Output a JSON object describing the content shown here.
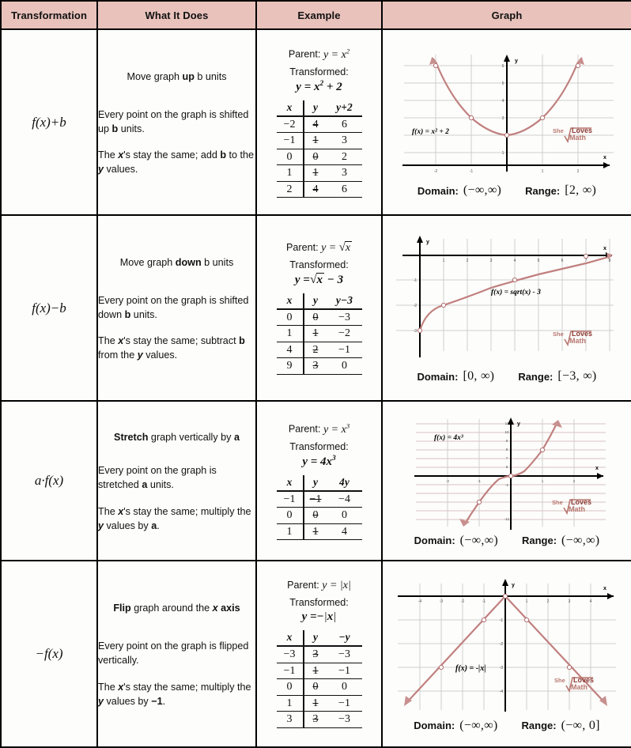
{
  "header": {
    "columns": [
      "Transformation",
      "What It Does",
      "Example",
      "Graph"
    ]
  },
  "watermark": {
    "line1": "She",
    "line2": "Loves",
    "line3": "Math"
  },
  "rows": [
    {
      "notation": "f(x)+b",
      "headline_pre": "Move graph ",
      "headline_bold": "up",
      "headline_post": " b units",
      "para1": "Every point on the graph is shifted up b units.",
      "para2": "The x's stay the same; add b to the y values.",
      "parent_label": "Parent:",
      "parent_eq": "y = x²",
      "transformed_label": "Transformed:",
      "transformed_eq": "y = x² + 2",
      "table": {
        "headers": [
          "x",
          "y",
          "y+2"
        ],
        "rows": [
          [
            "−2",
            "4",
            "6"
          ],
          [
            "−1",
            "1",
            "3"
          ],
          [
            "0",
            "0",
            "2"
          ],
          [
            "1",
            "1",
            "3"
          ],
          [
            "2",
            "4",
            "6"
          ]
        ]
      },
      "graph_label": "f(x) = x² + 2",
      "domain_label": "Domain:",
      "domain_value": "(−∞,∞)",
      "range_label": "Range:",
      "range_value": "[2, ∞)"
    },
    {
      "notation": "f(x)−b",
      "headline_pre": "Move graph ",
      "headline_bold": "down",
      "headline_post": " b units",
      "para1": "Every point on the graph is shifted down b units.",
      "para2": "The x's stay the same; subtract b from the y values.",
      "parent_label": "Parent:",
      "parent_eq": "y = √x",
      "transformed_label": "Transformed:",
      "transformed_eq": "y = √x − 3",
      "table": {
        "headers": [
          "x",
          "y",
          "y−3"
        ],
        "rows": [
          [
            "0",
            "0",
            "−3"
          ],
          [
            "1",
            "1",
            "−2"
          ],
          [
            "4",
            "2",
            "−1"
          ],
          [
            "9",
            "3",
            "0"
          ]
        ]
      },
      "graph_label": "f(x) = sqrt(x) - 3",
      "domain_label": "Domain:",
      "domain_value": "[0, ∞)",
      "range_label": "Range:",
      "range_value": "[−3, ∞)"
    },
    {
      "notation": "a·f(x)",
      "headline_pre": "",
      "headline_bold": "Stretch",
      "headline_post": " graph vertically by a",
      "para1": "Every point on the graph is stretched a units.",
      "para2": "The x's stay the same; multiply the y values by a.",
      "parent_label": "Parent:",
      "parent_eq": "y = x³",
      "transformed_label": "Transformed:",
      "transformed_eq": "y = 4x³",
      "table": {
        "headers": [
          "x",
          "y",
          "4y"
        ],
        "rows": [
          [
            "−1",
            "−1",
            "−4"
          ],
          [
            "0",
            "0",
            "0"
          ],
          [
            "1",
            "1",
            "4"
          ]
        ]
      },
      "graph_label": "f(x) = 4x³",
      "domain_label": "Domain:",
      "domain_value": "(−∞,∞)",
      "range_label": "Range:",
      "range_value": "(−∞,∞)"
    },
    {
      "notation": "−f(x)",
      "headline_pre": "",
      "headline_bold": "Flip",
      "headline_post": " graph around the x axis",
      "para1": "Every point on the graph is flipped vertically.",
      "para2": "The x's stay the same; multiply the y values by −1.",
      "parent_label": "Parent:",
      "parent_eq": "y = |x|",
      "transformed_label": "Transformed:",
      "transformed_eq": "y = −|x|",
      "table": {
        "headers": [
          "x",
          "y",
          "−y"
        ],
        "rows": [
          [
            "−3",
            "3",
            "−3"
          ],
          [
            "−1",
            "1",
            "−1"
          ],
          [
            "0",
            "0",
            "0"
          ],
          [
            "1",
            "1",
            "−1"
          ],
          [
            "3",
            "3",
            "−3"
          ]
        ]
      },
      "graph_label": "f(x) = -|x|",
      "domain_label": "Domain:",
      "domain_value": "(−∞,∞)",
      "range_label": "Range:",
      "range_value": "(−∞, 0]"
    }
  ],
  "colors": {
    "header_bg": "#e8c2bb",
    "curve": "#c0807f",
    "grid": "#cfcfcf",
    "axis": "#000000",
    "watermark": "#b8766f"
  }
}
